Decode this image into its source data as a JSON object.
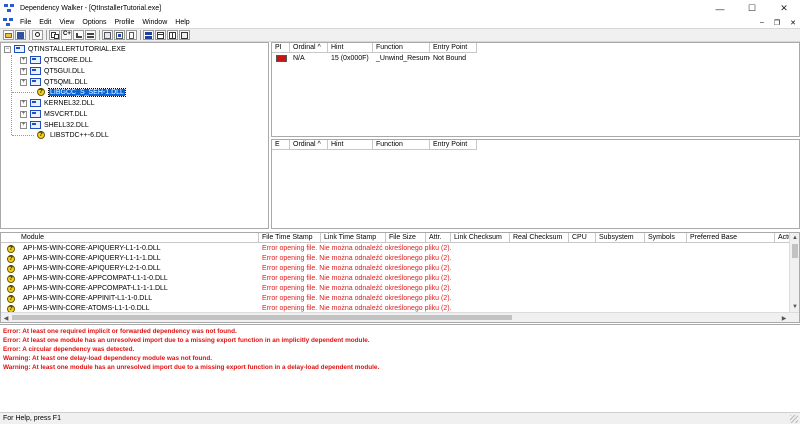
{
  "window": {
    "title": "Dependency Walker - [QtInstallerTutorial.exe]",
    "minimize": "—",
    "maximize": "☐",
    "close": "✕",
    "mdi_minimize": "–",
    "mdi_restore": "❐",
    "mdi_close": "✕"
  },
  "menu": [
    "File",
    "Edit",
    "View",
    "Options",
    "Profile",
    "Window",
    "Help"
  ],
  "toolbar": {
    "buttons": [
      "open-icon",
      "save-icon",
      "find-icon",
      "copy-icon",
      "c-plus-icon",
      "undecorate-icon",
      "full-paths-icon",
      "expand-icon",
      "highlight-icon",
      "configure-icon",
      "collapse-icon",
      "properties-icon",
      "system-info-icon",
      "module-list-icon",
      "window-split-icon"
    ]
  },
  "tree": {
    "root": "QTINSTALLERTUTORIAL.EXE",
    "children": [
      {
        "label": "QT5CORE.DLL",
        "icon": "module-icon",
        "expander": "+"
      },
      {
        "label": "QT5GUI.DLL",
        "icon": "module-icon",
        "expander": "+"
      },
      {
        "label": "QT5QML.DLL",
        "icon": "module-icon",
        "expander": "+"
      },
      {
        "label": "LIBGCC_S_SEH-1.DLL",
        "icon": "warning-icon",
        "expander": ""
      },
      {
        "label": "KERNEL32.DLL",
        "icon": "module-icon",
        "expander": "+"
      },
      {
        "label": "MSVCRT.DLL",
        "icon": "module-icon",
        "expander": "+"
      },
      {
        "label": "SHELL32.DLL",
        "icon": "module-icon",
        "expander": "+"
      },
      {
        "label": "LIBSTDC++-6.DLL",
        "icon": "warning-icon",
        "expander": ""
      }
    ],
    "selected": "LIBGCC_S_SEH-1.DLL"
  },
  "parent_imports": {
    "headers": [
      "PI",
      "Ordinal ^",
      "Hint",
      "Function",
      "Entry Point"
    ],
    "rows": [
      {
        "ordinal": "N/A",
        "hint": "15 (0x000F)",
        "function": "_Unwind_Resume",
        "entry_point": "Not Bound"
      }
    ]
  },
  "exports": {
    "headers": [
      "E",
      "Ordinal ^",
      "Hint",
      "Function",
      "Entry Point"
    ]
  },
  "modules": {
    "headers": [
      "Module",
      "File Time Stamp",
      "Link Time Stamp",
      "File Size",
      "Attr.",
      "Link Checksum",
      "Real Checksum",
      "CPU",
      "Subsystem",
      "Symbols",
      "Preferred Base",
      "Actu"
    ],
    "rows": [
      {
        "name": "API-MS-WIN-CORE-APIQUERY-L1-1-0.DLL",
        "error": "Error opening file. Nie można odnaleźć określonego pliku (2)."
      },
      {
        "name": "API-MS-WIN-CORE-APIQUERY-L1-1-1.DLL",
        "error": "Error opening file. Nie można odnaleźć określonego pliku (2)."
      },
      {
        "name": "API-MS-WIN-CORE-APIQUERY-L2-1-0.DLL",
        "error": "Error opening file. Nie można odnaleźć określonego pliku (2)."
      },
      {
        "name": "API-MS-WIN-CORE-APPCOMPAT-L1-1-0.DLL",
        "error": "Error opening file. Nie można odnaleźć określonego pliku (2)."
      },
      {
        "name": "API-MS-WIN-CORE-APPCOMPAT-L1-1-1.DLL",
        "error": "Error opening file. Nie można odnaleźć określonego pliku (2)."
      },
      {
        "name": "API-MS-WIN-CORE-APPINIT-L1-1-0.DLL",
        "error": "Error opening file. Nie można odnaleźć określonego pliku (2)."
      },
      {
        "name": "API-MS-WIN-CORE-ATOMS-L1-1-0.DLL",
        "error": "Error opening file. Nie można odnaleźć określonego pliku (2)."
      }
    ]
  },
  "log": [
    "Error: At least one required implicit or forwarded dependency was not found.",
    "Error: At least one module has an unresolved import due to a missing export function in an implicitly dependent module.",
    "Error: A circular dependency was detected.",
    "Warning: At least one delay-load dependency module was not found.",
    "Warning: At least one module has an unresolved import due to a missing export function in a delay-load dependent module."
  ],
  "status": "For Help, press F1",
  "colors": {
    "error": "#e02020",
    "selection": "#0a64d6",
    "pi_red": "#c81414",
    "warning_yellow": "#f4d020"
  }
}
